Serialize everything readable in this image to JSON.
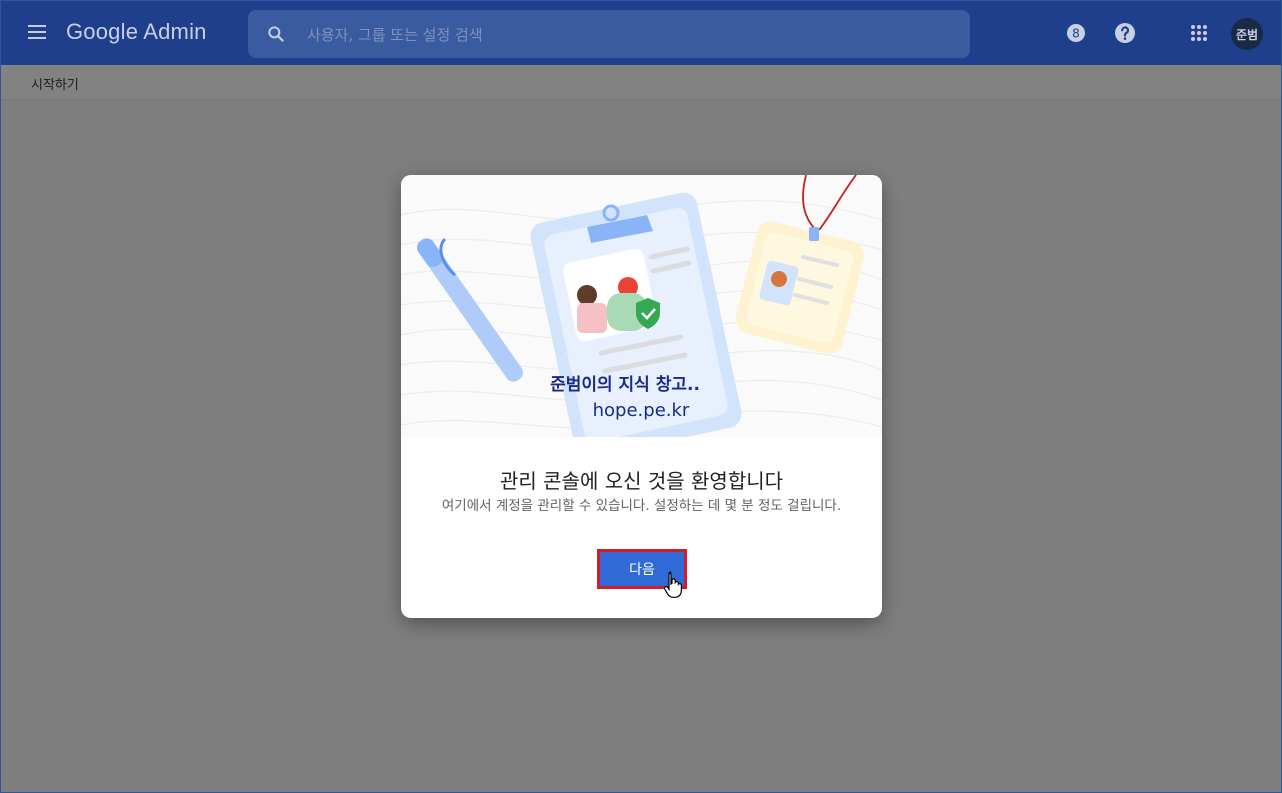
{
  "app": {
    "brand": "Google Admin",
    "search_placeholder": "사용자, 그룹 또는 설정 검색",
    "notification_count": "8",
    "avatar_initials": "준범"
  },
  "breadcrumb": {
    "label": "시작하기"
  },
  "dialog": {
    "watermark_line1": "준범이의 지식 창고..",
    "watermark_line2": "hope.pe.kr",
    "title": "관리 콘솔에 오신 것을 환영합니다",
    "description": "여기에서 계정을 관리할 수 있습니다. 설정하는 데 몇 분 정도 걸립니다.",
    "next_label": "다음"
  },
  "icons": {
    "menu": "menu-icon",
    "search": "search-icon",
    "notifications": "notification-badge-icon",
    "help": "help-icon",
    "apps": "apps-grid-icon",
    "cursor": "hand-pointer-icon"
  },
  "colors": {
    "topbar": "#1f3f8c",
    "overlay": "#7f7f7f",
    "button": "#2f6ad6",
    "highlight": "#d11d2a"
  }
}
